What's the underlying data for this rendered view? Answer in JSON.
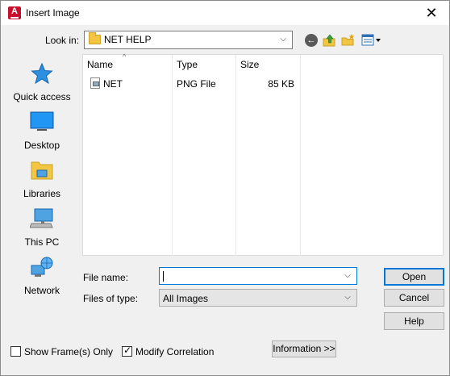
{
  "window": {
    "title": "Insert Image",
    "app_icon_letter": "A",
    "close_glyph": "✕"
  },
  "toolbar": {
    "look_in_label": "Look in:",
    "look_in_value": "NET HELP",
    "dropdown_glyph": "⌵",
    "back_glyph": "←",
    "icons": [
      "back-icon",
      "up-one-level-icon",
      "create-new-folder-icon",
      "views-menu-icon"
    ]
  },
  "places": [
    {
      "label": "Quick access",
      "icon": "quick-access-star-icon"
    },
    {
      "label": "Desktop",
      "icon": "desktop-icon"
    },
    {
      "label": "Libraries",
      "icon": "libraries-icon"
    },
    {
      "label": "This PC",
      "icon": "this-pc-icon"
    },
    {
      "label": "Network",
      "icon": "network-icon"
    }
  ],
  "file_list": {
    "columns": [
      "Name",
      "Type",
      "Size"
    ],
    "sort_glyph": "^",
    "rows": [
      {
        "name": "NET",
        "type": "PNG File",
        "size": "85 KB"
      }
    ]
  },
  "form": {
    "file_name_label": "File name:",
    "file_name_value": "",
    "files_of_type_label": "Files of type:",
    "files_of_type_value": "All Images"
  },
  "buttons": {
    "open": "Open",
    "cancel": "Cancel",
    "help": "Help",
    "information": "Information >>"
  },
  "options": {
    "show_frames_label": "Show Frame(s) Only",
    "show_frames_checked": false,
    "modify_correlation_label": "Modify Correlation",
    "modify_correlation_checked": true,
    "check_glyph": "✓"
  },
  "colors": {
    "accent": "#0078d7",
    "app_icon": "#c8102e",
    "folder": "#f4c542"
  }
}
